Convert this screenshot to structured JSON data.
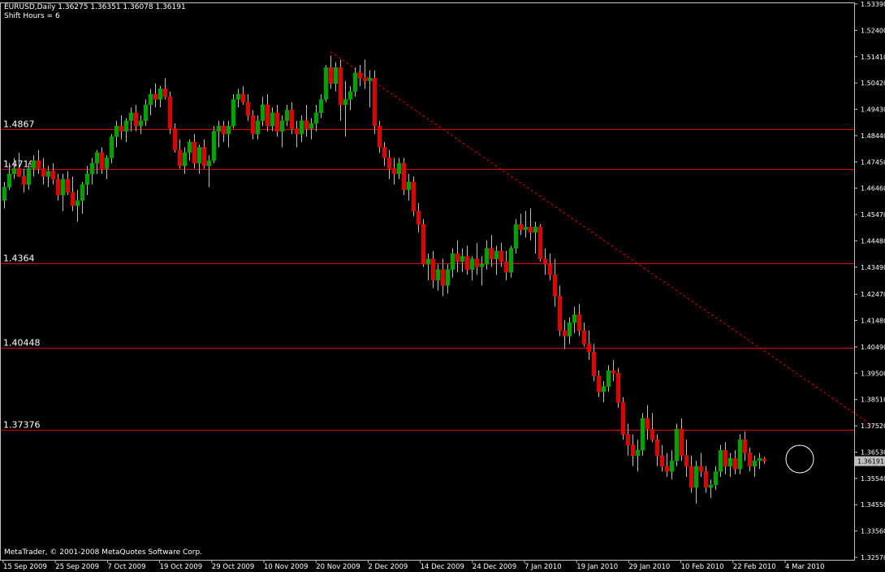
{
  "header": {
    "symbol_line": "EURUSD,Daily  1.36275 1.36351 1.36078 1.36191",
    "shift_line": "Shift Hours = 6"
  },
  "footer": {
    "copyright": "MetaTrader, © 2001-2008 MetaQuotes Software Corp."
  },
  "colors": {
    "background": "#000000",
    "frame": "#c0c0c0",
    "bull": "#00a000",
    "bear": "#e00000",
    "wick": "#c0c0c0",
    "hline": "#e00000",
    "trend": "#e00000",
    "marker": "#ffffff"
  },
  "chart_data": {
    "type": "candlestick",
    "title": "EURUSD,Daily",
    "ylim": [
      1.3257,
      1.5339
    ],
    "current_price": 1.36191,
    "y_ticks": [
      1.5339,
      1.524,
      1.5141,
      1.5042,
      1.4943,
      1.4844,
      1.4745,
      1.4646,
      1.4547,
      1.4448,
      1.4349,
      1.4247,
      1.4148,
      1.4049,
      1.395,
      1.3851,
      1.3752,
      1.3653,
      1.3554,
      1.3455,
      1.3356,
      1.3257
    ],
    "y_tick_labels": [
      "1.53390",
      "1.52400",
      "1.51410",
      "1.50420",
      "1.49430",
      "1.48440",
      "1.47450",
      "1.46460",
      "1.45470",
      "1.44480",
      "1.43490",
      "1.42470",
      "1.41480",
      "1.40490",
      "1.39500",
      "1.38510",
      "1.37520",
      "1.36530",
      "1.35540",
      "1.34550",
      "1.33560",
      "1.32570"
    ],
    "x_labels": [
      "15 Sep 2009",
      "25 Sep 2009",
      "7 Oct 2009",
      "19 Oct 2009",
      "29 Oct 2009",
      "10 Nov 2009",
      "20 Nov 2009",
      "2 Dec 2009",
      "14 Dec 2009",
      "24 Dec 2009",
      "7 Jan 2010",
      "19 Jan 2010",
      "29 Jan 2010",
      "10 Feb 2010",
      "22 Feb 2010",
      "4 Mar 2010"
    ],
    "horizontal_lines": [
      {
        "label": "1.4867",
        "value": 1.4867
      },
      {
        "label": "1.4719",
        "value": 1.4719
      },
      {
        "label": "1.4364",
        "value": 1.4364
      },
      {
        "label": "1.40448",
        "value": 1.40448
      },
      {
        "label": "1.37376",
        "value": 1.37376
      }
    ],
    "trendline": {
      "from": {
        "bar": 67,
        "price": 1.516
      },
      "to": {
        "bar": 175,
        "price": 1.377
      },
      "style": "dashed"
    },
    "highlight_circle": {
      "bar": 162,
      "price": 1.3621
    },
    "candles": [
      [
        1.46,
        1.467,
        1.457,
        1.465
      ],
      [
        1.465,
        1.474,
        1.464,
        1.47
      ],
      [
        1.47,
        1.476,
        1.468,
        1.472
      ],
      [
        1.472,
        1.478,
        1.47,
        1.469
      ],
      [
        1.469,
        1.472,
        1.463,
        1.466
      ],
      [
        1.466,
        1.474,
        1.464,
        1.472
      ],
      [
        1.472,
        1.477,
        1.469,
        1.475
      ],
      [
        1.475,
        1.479,
        1.47,
        1.472
      ],
      [
        1.472,
        1.476,
        1.466,
        1.469
      ],
      [
        1.469,
        1.473,
        1.465,
        1.471
      ],
      [
        1.471,
        1.474,
        1.466,
        1.468
      ],
      [
        1.468,
        1.47,
        1.46,
        1.462
      ],
      [
        1.462,
        1.47,
        1.456,
        1.468
      ],
      [
        1.468,
        1.471,
        1.462,
        1.463
      ],
      [
        1.463,
        1.469,
        1.456,
        1.458
      ],
      [
        1.458,
        1.464,
        1.452,
        1.46
      ],
      [
        1.46,
        1.467,
        1.455,
        1.466
      ],
      [
        1.466,
        1.473,
        1.462,
        1.47
      ],
      [
        1.47,
        1.476,
        1.466,
        1.474
      ],
      [
        1.474,
        1.479,
        1.47,
        1.478
      ],
      [
        1.478,
        1.48,
        1.47,
        1.472
      ],
      [
        1.472,
        1.477,
        1.468,
        1.476
      ],
      [
        1.476,
        1.485,
        1.474,
        1.484
      ],
      [
        1.484,
        1.49,
        1.48,
        1.488
      ],
      [
        1.488,
        1.492,
        1.483,
        1.486
      ],
      [
        1.486,
        1.491,
        1.482,
        1.49
      ],
      [
        1.49,
        1.495,
        1.486,
        1.493
      ],
      [
        1.493,
        1.496,
        1.486,
        1.488
      ],
      [
        1.488,
        1.492,
        1.485,
        1.49
      ],
      [
        1.49,
        1.498,
        1.488,
        1.496
      ],
      [
        1.496,
        1.502,
        1.492,
        1.5
      ],
      [
        1.5,
        1.504,
        1.495,
        1.498
      ],
      [
        1.498,
        1.503,
        1.495,
        1.502
      ],
      [
        1.502,
        1.506,
        1.498,
        1.499
      ],
      [
        1.499,
        1.501,
        1.485,
        1.487
      ],
      [
        1.487,
        1.489,
        1.478,
        1.479
      ],
      [
        1.479,
        1.483,
        1.472,
        1.473
      ],
      [
        1.473,
        1.48,
        1.47,
        1.478
      ],
      [
        1.478,
        1.483,
        1.475,
        1.482
      ],
      [
        1.482,
        1.485,
        1.472,
        1.474
      ],
      [
        1.474,
        1.481,
        1.47,
        1.48
      ],
      [
        1.48,
        1.483,
        1.472,
        1.473
      ],
      [
        1.473,
        1.477,
        1.465,
        1.475
      ],
      [
        1.475,
        1.488,
        1.474,
        1.486
      ],
      [
        1.486,
        1.49,
        1.48,
        1.488
      ],
      [
        1.488,
        1.49,
        1.482,
        1.485
      ],
      [
        1.485,
        1.49,
        1.48,
        1.488
      ],
      [
        1.488,
        1.5,
        1.487,
        1.498
      ],
      [
        1.498,
        1.502,
        1.495,
        1.5
      ],
      [
        1.5,
        1.503,
        1.496,
        1.497
      ],
      [
        1.497,
        1.5,
        1.49,
        1.492
      ],
      [
        1.492,
        1.494,
        1.483,
        1.485
      ],
      [
        1.485,
        1.492,
        1.483,
        1.49
      ],
      [
        1.49,
        1.499,
        1.488,
        1.496
      ],
      [
        1.496,
        1.5,
        1.486,
        1.488
      ],
      [
        1.488,
        1.495,
        1.486,
        1.493
      ],
      [
        1.493,
        1.496,
        1.484,
        1.486
      ],
      [
        1.486,
        1.492,
        1.48,
        1.49
      ],
      [
        1.49,
        1.496,
        1.488,
        1.494
      ],
      [
        1.494,
        1.497,
        1.485,
        1.487
      ],
      [
        1.487,
        1.49,
        1.48,
        1.485
      ],
      [
        1.485,
        1.492,
        1.482,
        1.49
      ],
      [
        1.49,
        1.496,
        1.484,
        1.487
      ],
      [
        1.487,
        1.491,
        1.483,
        1.489
      ],
      [
        1.489,
        1.496,
        1.486,
        1.493
      ],
      [
        1.493,
        1.5,
        1.491,
        1.498
      ],
      [
        1.498,
        1.511,
        1.497,
        1.51
      ],
      [
        1.51,
        1.5145,
        1.502,
        1.504
      ],
      [
        1.504,
        1.512,
        1.501,
        1.51
      ],
      [
        1.51,
        1.513,
        1.49,
        1.496
      ],
      [
        1.496,
        1.505,
        1.484,
        1.498
      ],
      [
        1.498,
        1.503,
        1.494,
        1.501
      ],
      [
        1.501,
        1.51,
        1.499,
        1.508
      ],
      [
        1.508,
        1.511,
        1.503,
        1.506
      ],
      [
        1.506,
        1.513,
        1.502,
        1.505
      ],
      [
        1.505,
        1.509,
        1.495,
        1.506
      ],
      [
        1.506,
        1.509,
        1.485,
        1.488
      ],
      [
        1.488,
        1.49,
        1.478,
        1.48
      ],
      [
        1.48,
        1.482,
        1.473,
        1.476
      ],
      [
        1.476,
        1.479,
        1.468,
        1.472
      ],
      [
        1.472,
        1.476,
        1.466,
        1.47
      ],
      [
        1.47,
        1.476,
        1.468,
        1.474
      ],
      [
        1.474,
        1.476,
        1.462,
        1.464
      ],
      [
        1.464,
        1.47,
        1.46,
        1.467
      ],
      [
        1.467,
        1.469,
        1.454,
        1.456
      ],
      [
        1.456,
        1.459,
        1.448,
        1.451
      ],
      [
        1.451,
        1.453,
        1.435,
        1.436
      ],
      [
        1.436,
        1.44,
        1.43,
        1.438
      ],
      [
        1.438,
        1.441,
        1.427,
        1.43
      ],
      [
        1.43,
        1.436,
        1.426,
        1.434
      ],
      [
        1.434,
        1.438,
        1.424,
        1.428
      ],
      [
        1.428,
        1.436,
        1.425,
        1.434
      ],
      [
        1.434,
        1.442,
        1.431,
        1.44
      ],
      [
        1.44,
        1.445,
        1.433,
        1.437
      ],
      [
        1.437,
        1.442,
        1.433,
        1.439
      ],
      [
        1.439,
        1.443,
        1.432,
        1.434
      ],
      [
        1.434,
        1.439,
        1.43,
        1.438
      ],
      [
        1.438,
        1.444,
        1.432,
        1.435
      ],
      [
        1.435,
        1.439,
        1.428,
        1.436
      ],
      [
        1.436,
        1.445,
        1.434,
        1.442
      ],
      [
        1.442,
        1.447,
        1.435,
        1.438
      ],
      [
        1.438,
        1.443,
        1.432,
        1.441
      ],
      [
        1.441,
        1.444,
        1.435,
        1.437
      ],
      [
        1.437,
        1.441,
        1.43,
        1.433
      ],
      [
        1.433,
        1.443,
        1.431,
        1.442
      ],
      [
        1.442,
        1.453,
        1.44,
        1.451
      ],
      [
        1.451,
        1.455,
        1.447,
        1.449
      ],
      [
        1.449,
        1.456,
        1.446,
        1.45
      ],
      [
        1.45,
        1.457,
        1.445,
        1.448
      ],
      [
        1.448,
        1.452,
        1.44,
        1.45
      ],
      [
        1.45,
        1.451,
        1.437,
        1.438
      ],
      [
        1.438,
        1.442,
        1.432,
        1.436
      ],
      [
        1.436,
        1.44,
        1.43,
        1.432
      ],
      [
        1.432,
        1.438,
        1.42,
        1.424
      ],
      [
        1.424,
        1.428,
        1.409,
        1.411
      ],
      [
        1.411,
        1.415,
        1.404,
        1.409
      ],
      [
        1.409,
        1.416,
        1.406,
        1.414
      ],
      [
        1.414,
        1.42,
        1.41,
        1.417
      ],
      [
        1.417,
        1.421,
        1.409,
        1.411
      ],
      [
        1.411,
        1.414,
        1.405,
        1.406
      ],
      [
        1.406,
        1.411,
        1.4,
        1.403
      ],
      [
        1.403,
        1.406,
        1.392,
        1.394
      ],
      [
        1.394,
        1.396,
        1.386,
        1.388
      ],
      [
        1.388,
        1.392,
        1.384,
        1.39
      ],
      [
        1.39,
        1.398,
        1.388,
        1.396
      ],
      [
        1.396,
        1.4,
        1.392,
        1.395
      ],
      [
        1.395,
        1.397,
        1.382,
        1.384
      ],
      [
        1.384,
        1.386,
        1.37,
        1.372
      ],
      [
        1.372,
        1.376,
        1.364,
        1.368
      ],
      [
        1.368,
        1.372,
        1.36,
        1.364
      ],
      [
        1.364,
        1.37,
        1.358,
        1.366
      ],
      [
        1.366,
        1.38,
        1.364,
        1.378
      ],
      [
        1.378,
        1.383,
        1.37,
        1.374
      ],
      [
        1.374,
        1.38,
        1.369,
        1.37
      ],
      [
        1.37,
        1.372,
        1.36,
        1.364
      ],
      [
        1.364,
        1.368,
        1.358,
        1.36
      ],
      [
        1.36,
        1.365,
        1.356,
        1.358
      ],
      [
        1.358,
        1.366,
        1.355,
        1.362
      ],
      [
        1.362,
        1.376,
        1.36,
        1.374
      ],
      [
        1.374,
        1.378,
        1.362,
        1.364
      ],
      [
        1.364,
        1.37,
        1.356,
        1.36
      ],
      [
        1.36,
        1.364,
        1.35,
        1.352
      ],
      [
        1.352,
        1.362,
        1.346,
        1.36
      ],
      [
        1.36,
        1.365,
        1.356,
        1.358
      ],
      [
        1.358,
        1.36,
        1.35,
        1.352
      ],
      [
        1.352,
        1.355,
        1.348,
        1.353
      ],
      [
        1.353,
        1.36,
        1.351,
        1.358
      ],
      [
        1.358,
        1.368,
        1.356,
        1.366
      ],
      [
        1.366,
        1.369,
        1.357,
        1.36
      ],
      [
        1.36,
        1.365,
        1.356,
        1.363
      ],
      [
        1.363,
        1.366,
        1.357,
        1.359
      ],
      [
        1.359,
        1.372,
        1.357,
        1.37
      ],
      [
        1.37,
        1.373,
        1.362,
        1.365
      ],
      [
        1.365,
        1.367,
        1.358,
        1.36
      ],
      [
        1.36,
        1.364,
        1.356,
        1.362
      ],
      [
        1.362,
        1.365,
        1.359,
        1.363
      ],
      [
        1.36275,
        1.36351,
        1.36078,
        1.36191
      ]
    ]
  }
}
